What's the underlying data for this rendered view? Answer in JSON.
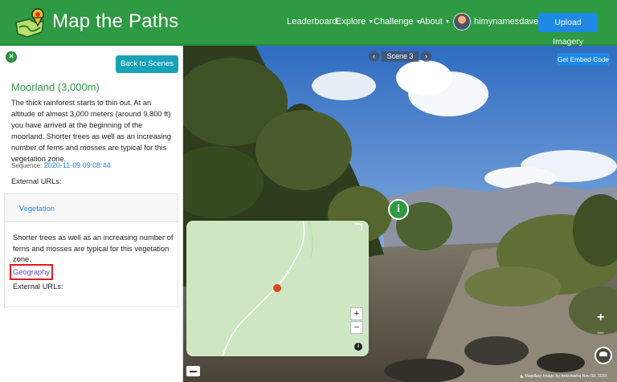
{
  "header": {
    "brand": "Map the Paths",
    "nav": [
      {
        "label": "Leaderboard"
      },
      {
        "label": "Explore"
      },
      {
        "label": "Challenge"
      },
      {
        "label": "About"
      }
    ],
    "username": "himynamesdave",
    "upload_label": "Upload Imagery",
    "accent": "#2e9a43"
  },
  "sidebar": {
    "back_label": "Back to Scenes",
    "scene_title": "Moorland (3,000m)",
    "scene_description": "The thick rainforest starts to thin out. At an altitude of almost 3,000 meters (around 9,800 ft) you have arrived at the beginning of the moorland. Shorter trees as well as an increasing number of ferns and mosses are typical for this vegetation zone.",
    "sequence_label": "Sequence:",
    "sequence_value": "2020-11-09 09:08:44",
    "external_urls": "External URLs:",
    "card": {
      "title": "Vegetation",
      "text": "Shorter trees as well as an increasing number of ferns and mosses are typical for this vegetation zone.",
      "tag": "Geography",
      "external_urls": "External URLs:"
    }
  },
  "viewer": {
    "scene_label": "Scene 3",
    "prev_icon": "‹",
    "next_icon": "›",
    "embed_label": "Get Embed Code",
    "info_marker": "i",
    "zoom_in": "+",
    "zoom_out": "−",
    "map_info": "i",
    "viewer_zoom_in": "+",
    "viewer_zoom_out": "−",
    "attribution": "◣ Mapillary   Image by trekviewhq Nov 09, 2020"
  }
}
